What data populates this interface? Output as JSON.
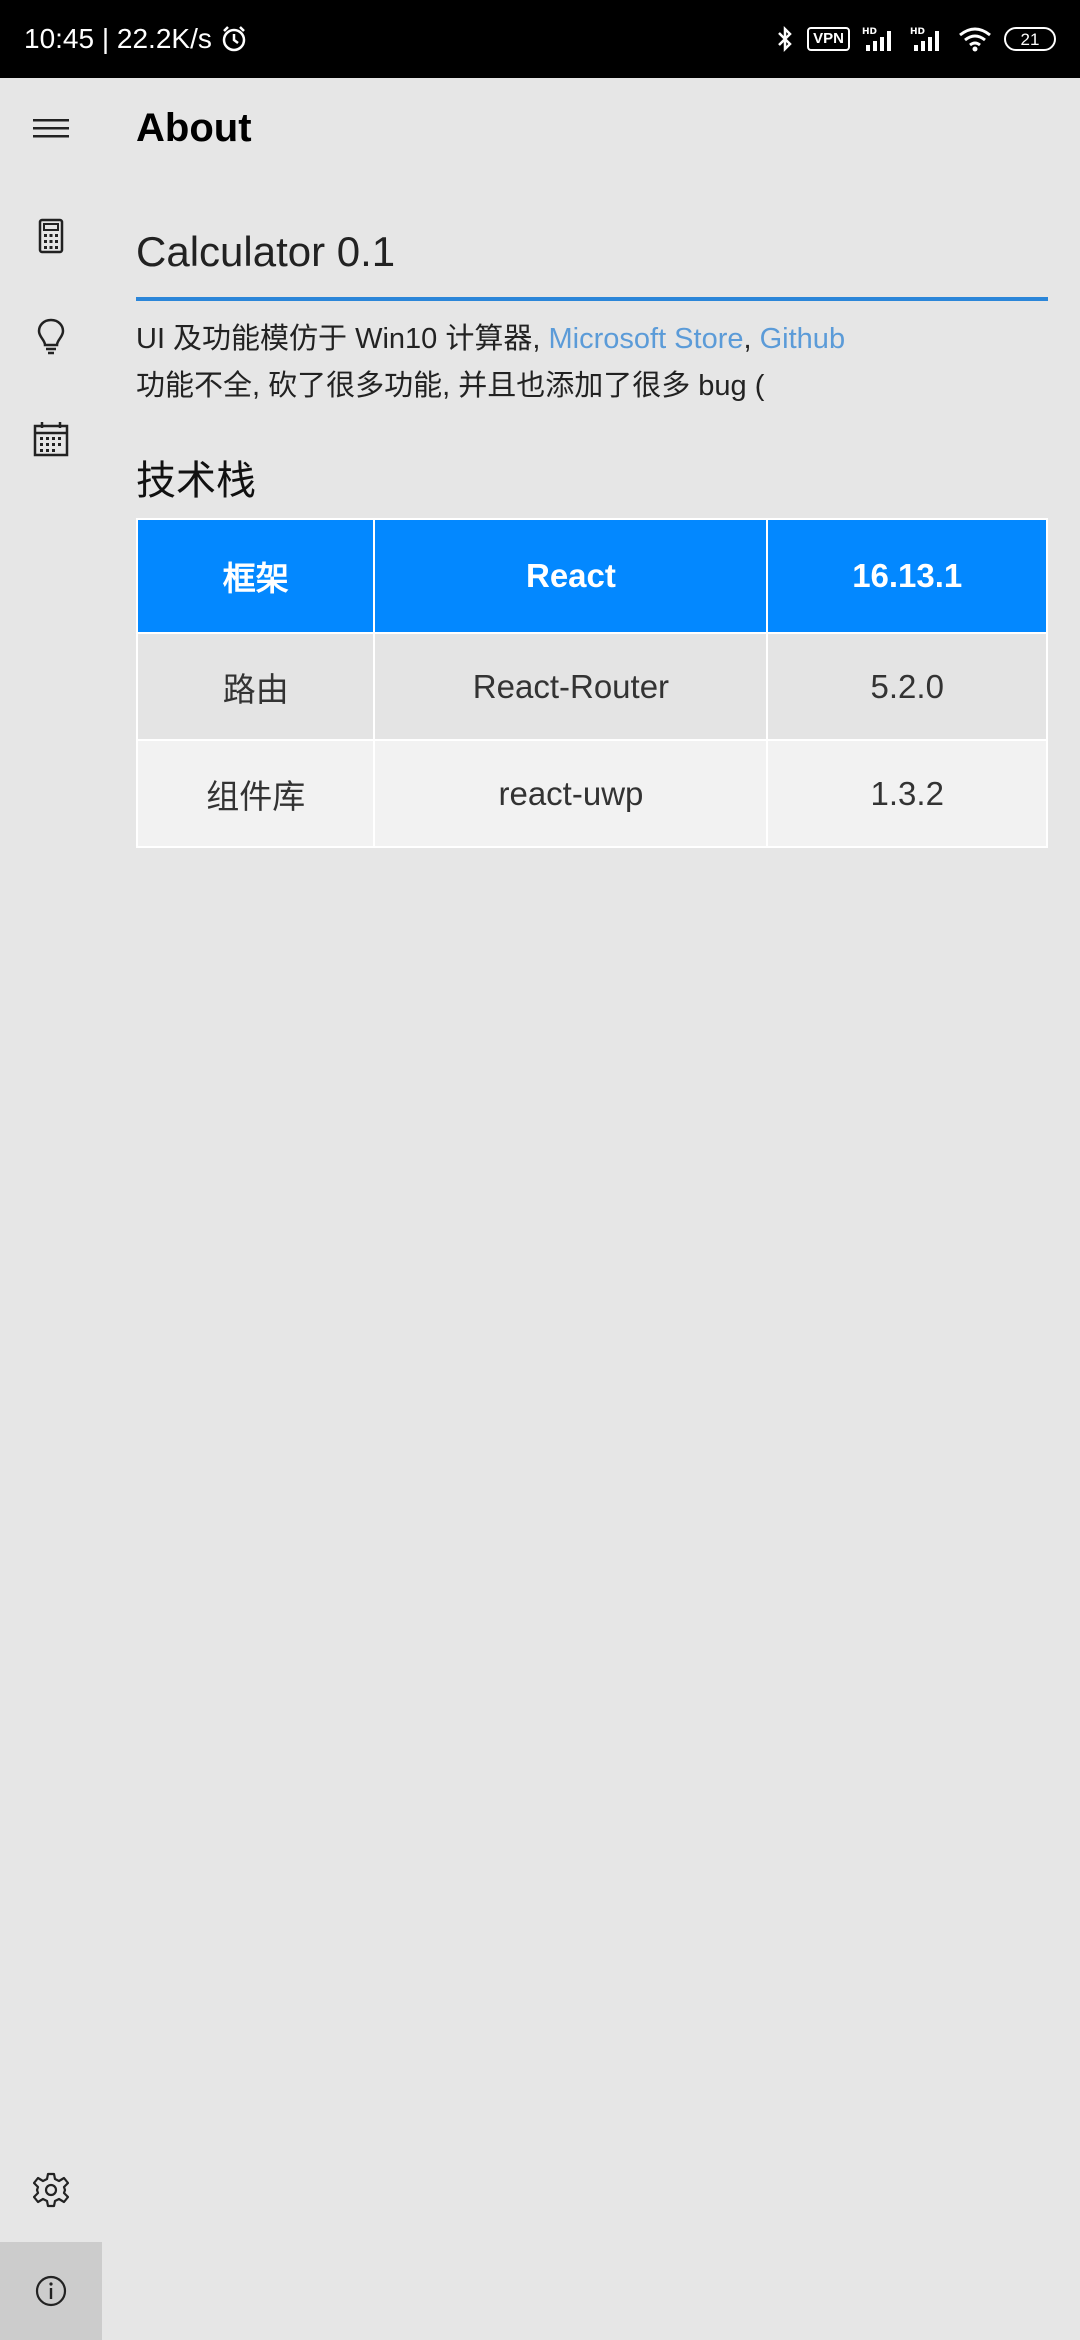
{
  "status_bar": {
    "time_speed": "10:45 | 22.2K/s",
    "vpn": "VPN",
    "battery": "21"
  },
  "sidebar": {
    "items": [
      {
        "icon": "hamburger-menu-icon"
      },
      {
        "icon": "calculator-icon"
      },
      {
        "icon": "lightbulb-icon"
      },
      {
        "icon": "calendar-icon"
      },
      {
        "icon": "gear-icon"
      },
      {
        "icon": "info-icon",
        "active": true
      }
    ]
  },
  "page": {
    "title": "About",
    "app_name": "Calculator 0.1",
    "description": {
      "line1_prefix": "UI 及功能模仿于 Win10 计算器, ",
      "link_store": "Microsoft Store",
      "separator": ", ",
      "link_github": "Github",
      "line2": "功能不全, 砍了很多功能, 并且也添加了很多 bug ("
    },
    "section_title": "技术栈"
  },
  "tech_table": {
    "header": [
      "框架",
      "React",
      "16.13.1"
    ],
    "rows": [
      [
        "路由",
        "React-Router",
        "5.2.0"
      ],
      [
        "组件库",
        "react-uwp",
        "1.3.2"
      ]
    ]
  },
  "colors": {
    "accent": "#0388ff",
    "underline": "#2b86d9",
    "link": "#5b9bd8",
    "background": "#e6e6e6"
  }
}
